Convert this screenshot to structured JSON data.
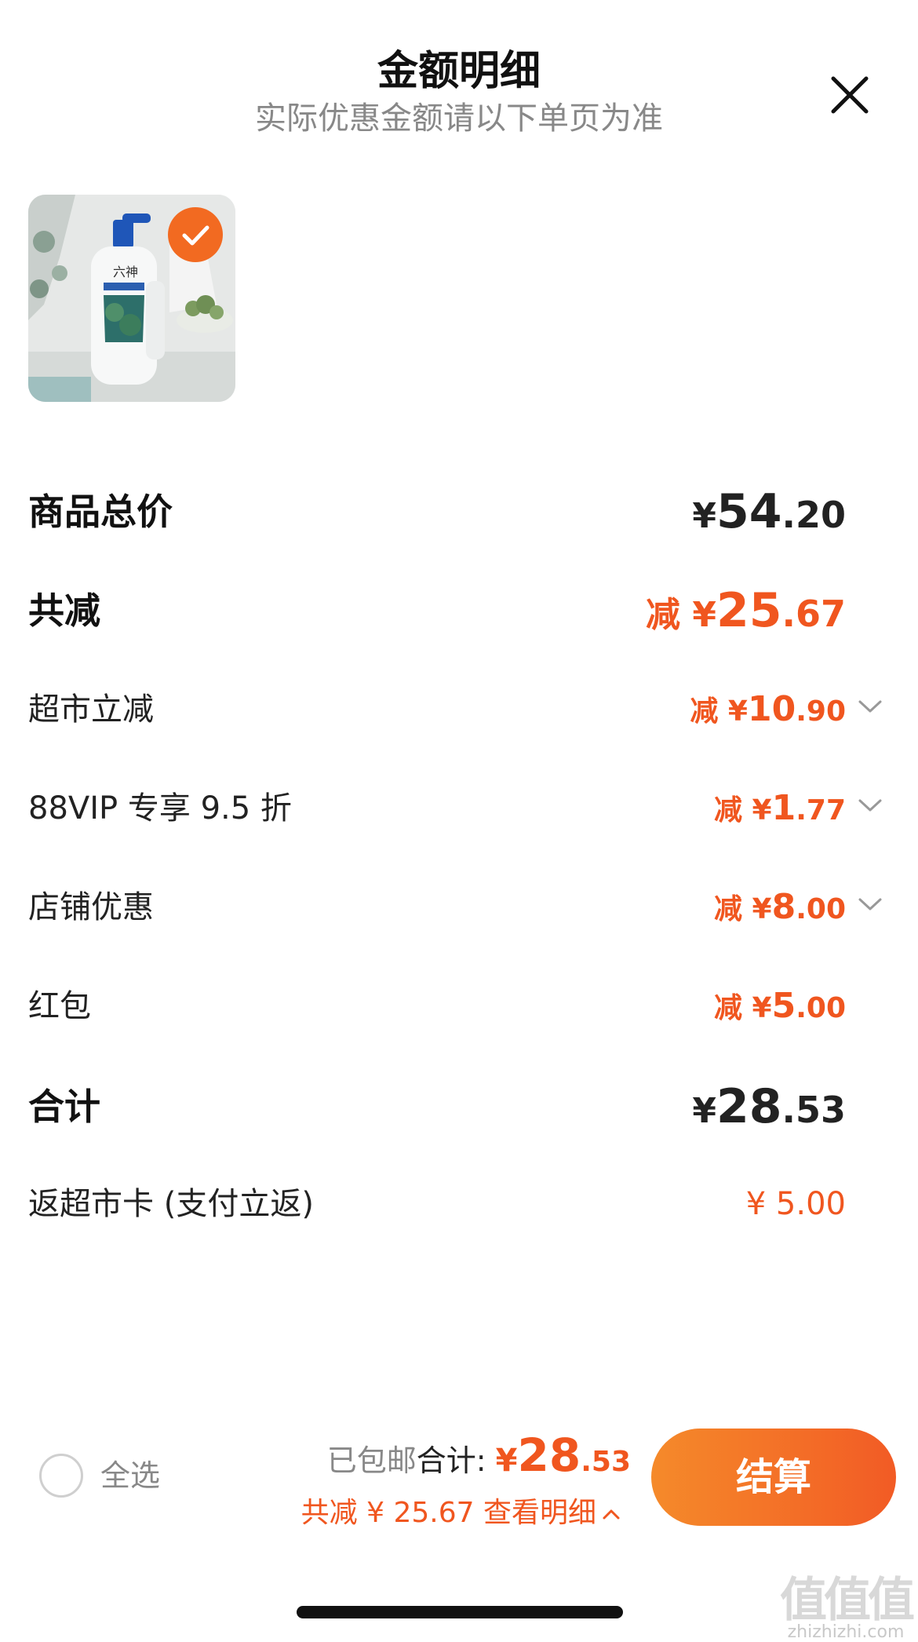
{
  "header": {
    "title": "金额明细",
    "subtitle": "实际优惠金额请以下单页为准"
  },
  "colors": {
    "accent": "#f0561f",
    "text": "#111111",
    "muted": "#888888"
  },
  "product": {
    "selected": true
  },
  "rows": [
    {
      "label": "商品总价",
      "currency": "¥",
      "int": "54",
      "dec": ".20",
      "style": "dark"
    },
    {
      "label": "共减",
      "prefix": "减",
      "currency": "¥",
      "int": "25",
      "dec": ".67",
      "style": "accent"
    },
    {
      "label": "超市立减",
      "prefix": "减",
      "currency": "¥",
      "int": "10",
      "dec": ".90",
      "expandable": true
    },
    {
      "label": "88VIP 专享 9.5 折",
      "prefix": "减",
      "currency": "¥",
      "int": "1",
      "dec": ".77",
      "expandable": true
    },
    {
      "label": "店铺优惠",
      "prefix": "减",
      "currency": "¥",
      "int": "8",
      "dec": ".00",
      "expandable": true
    },
    {
      "label": "红包",
      "prefix": "减",
      "currency": "¥",
      "int": "5",
      "dec": ".00"
    },
    {
      "label": "合计",
      "currency": "¥",
      "int": "28",
      "dec": ".53",
      "style": "dark"
    },
    {
      "label": "返超市卡 (支付立返)",
      "value": "¥ 5.00"
    }
  ],
  "footer": {
    "select_all": "全选",
    "shipping": "已包邮",
    "total_label": "合计:",
    "total_currency": "¥",
    "total_int": "28",
    "total_dec": ".53",
    "discount_text": "共减 ¥ 25.67",
    "detail_link": "查看明细",
    "checkout": "结算"
  },
  "watermark": {
    "big": "值值值",
    "small": "zhizhizhi.com"
  }
}
